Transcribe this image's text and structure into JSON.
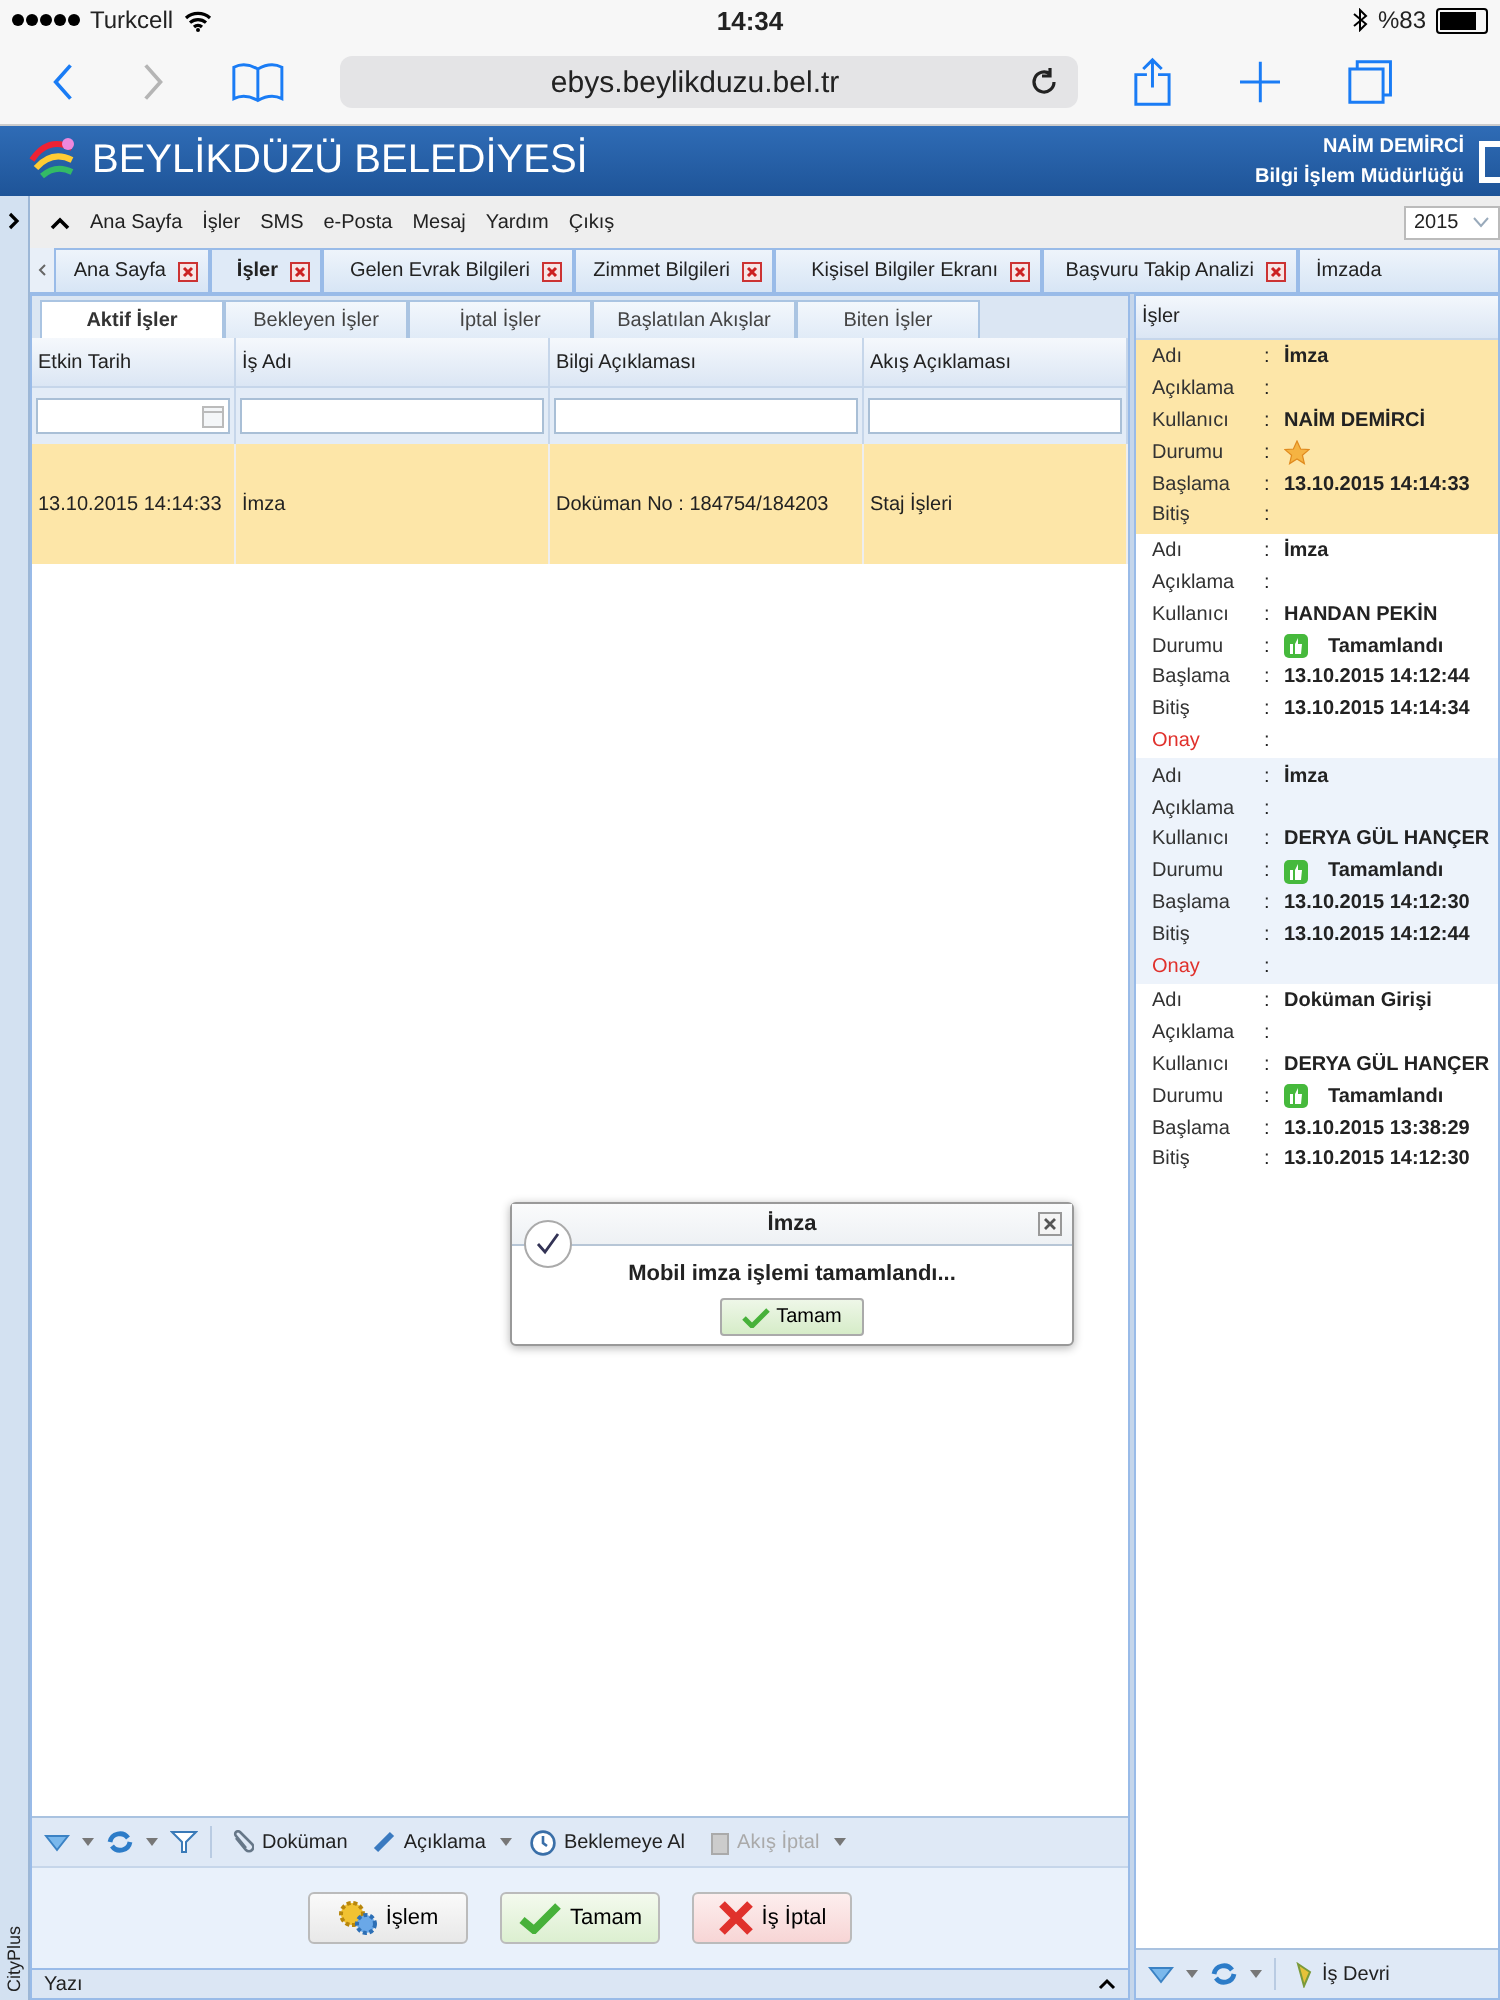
{
  "status_bar": {
    "carrier": "Turkcell",
    "time": "14:34",
    "battery": "%83"
  },
  "browser": {
    "url": "ebys.beylikduzu.bel.tr"
  },
  "header": {
    "title": "BEYLİKDÜZÜ BELEDİYESİ",
    "user": "NAİM DEMİRCİ",
    "department": "Bilgi İşlem Müdürlüğü"
  },
  "side_strip": {
    "label": "CityPlus"
  },
  "menu": {
    "items": [
      "Ana Sayfa",
      "İşler",
      "SMS",
      "e-Posta",
      "Mesaj",
      "Yardım",
      "Çıkış"
    ],
    "year": "2015"
  },
  "tabs": [
    {
      "label": "Ana Sayfa",
      "selected": false
    },
    {
      "label": "İşler",
      "selected": true
    },
    {
      "label": "Gelen Evrak Bilgileri",
      "selected": false
    },
    {
      "label": "Zimmet Bilgileri",
      "selected": false
    },
    {
      "label": "Kişisel Bilgiler Ekranı",
      "selected": false
    },
    {
      "label": "Başvuru Takip Analizi",
      "selected": false
    },
    {
      "label": "İmzada",
      "selected": false
    }
  ],
  "subtabs": [
    {
      "label": "Aktif İşler",
      "selected": true
    },
    {
      "label": "Bekleyen İşler",
      "selected": false
    },
    {
      "label": "İptal İşler",
      "selected": false
    },
    {
      "label": "Başlatılan Akışlar",
      "selected": false
    },
    {
      "label": "Biten İşler",
      "selected": false
    }
  ],
  "table": {
    "columns": [
      {
        "label": "Etkin Tarih",
        "kind": "date"
      },
      {
        "label": "İş Adı",
        "kind": "text"
      },
      {
        "label": "Bilgi Açıklaması",
        "kind": "text"
      },
      {
        "label": "Akış Açıklaması",
        "kind": "text"
      }
    ],
    "rows": [
      {
        "selected": true,
        "cells": [
          "13.10.2015 14:14:33",
          "İmza",
          "Doküman No : 184754/184203",
          "Staj İşleri"
        ]
      }
    ]
  },
  "toolbar": {
    "items": [
      {
        "label": "Doküman",
        "disabled": false,
        "dropdown": false
      },
      {
        "label": "Açıklama",
        "disabled": false,
        "dropdown": true
      },
      {
        "label": "Beklemeye Al",
        "disabled": false,
        "dropdown": false
      },
      {
        "label": "Akış İptal",
        "disabled": true,
        "dropdown": true
      }
    ]
  },
  "actions": [
    {
      "label": "İşlem",
      "kind": "neutral"
    },
    {
      "label": "Tamam",
      "kind": "ok"
    },
    {
      "label": "İş İptal",
      "kind": "cancel"
    }
  ],
  "bottom_panel": {
    "title": "Yazı"
  },
  "right_panel": {
    "title": "İşler",
    "entries": [
      {
        "selected": true,
        "fields": [
          {
            "label": "Adı",
            "sep": ":",
            "value": "İmza"
          },
          {
            "label": "Açıklama",
            "sep": ":"
          },
          {
            "label": "Kullanıcı",
            "sep": ":",
            "value": "NAİM DEMİRCİ"
          },
          {
            "label": "Durumu",
            "sep": ":",
            "kind": "pending"
          },
          {
            "label": "Başlama",
            "sep": ":",
            "value": "13.10.2015 14:14:33"
          },
          {
            "label": "Bitiş",
            "sep": ":"
          }
        ]
      },
      {
        "selected": false,
        "fields": [
          {
            "label": "Adı",
            "sep": ":",
            "value": "İmza"
          },
          {
            "label": "Açıklama",
            "sep": ":"
          },
          {
            "label": "Kullanıcı",
            "sep": ":",
            "value": "HANDAN PEKİN"
          },
          {
            "label": "Durumu",
            "sep": ":",
            "kind": "done",
            "value": "Tamamlandı"
          },
          {
            "label": "Başlama",
            "sep": ":",
            "value": "13.10.2015 14:12:44"
          },
          {
            "label": "Bitiş",
            "sep": ":",
            "value": "13.10.2015 14:14:34"
          },
          {
            "label": "Onay",
            "sep": ":",
            "kind": "approval"
          }
        ]
      },
      {
        "selected": false,
        "fields": [
          {
            "label": "Adı",
            "sep": ":",
            "value": "İmza"
          },
          {
            "label": "Açıklama",
            "sep": ":"
          },
          {
            "label": "Kullanıcı",
            "sep": ":",
            "value": "DERYA GÜL HANÇER"
          },
          {
            "label": "Durumu",
            "sep": ":",
            "kind": "done",
            "value": "Tamamlandı"
          },
          {
            "label": "Başlama",
            "sep": ":",
            "value": "13.10.2015 14:12:30"
          },
          {
            "label": "Bitiş",
            "sep": ":",
            "value": "13.10.2015 14:12:44"
          },
          {
            "label": "Onay",
            "sep": ":",
            "kind": "approval"
          }
        ]
      },
      {
        "selected": false,
        "fields": [
          {
            "label": "Adı",
            "sep": ":",
            "value": "Doküman Girişi"
          },
          {
            "label": "Açıklama",
            "sep": ":"
          },
          {
            "label": "Kullanıcı",
            "sep": ":",
            "value": "DERYA GÜL HANÇER"
          },
          {
            "label": "Durumu",
            "sep": ":",
            "kind": "done",
            "value": "Tamamlandı"
          },
          {
            "label": "Başlama",
            "sep": ":",
            "value": "13.10.2015 13:38:29"
          },
          {
            "label": "Bitiş",
            "sep": ":",
            "value": "13.10.2015 14:12:30"
          }
        ]
      }
    ],
    "toolbar_button": "İş Devri"
  },
  "dialog": {
    "title": "İmza",
    "message": "Mobil imza işlemi tamamlandı...",
    "button": "Tamam"
  }
}
